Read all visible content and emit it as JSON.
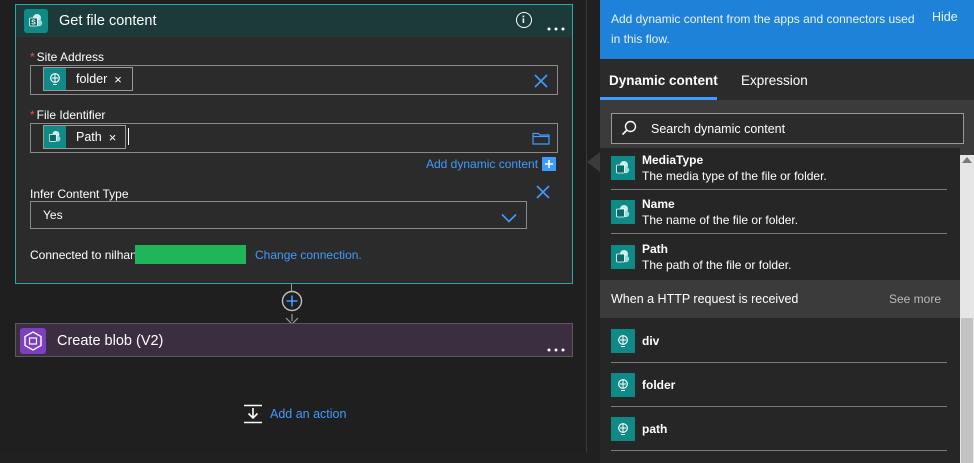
{
  "action": {
    "title": "Get file content",
    "site_address_label": "Site Address",
    "site_address_token": "folder",
    "file_identifier_label": "File Identifier",
    "file_identifier_token": "Path",
    "add_dynamic_content": "Add dynamic content",
    "infer_label": "Infer Content Type",
    "infer_value": "Yes",
    "connected_to": "Connected to nilhan",
    "change_connection": "Change connection.",
    "token_close": "×",
    "required_mark": "*"
  },
  "next_action": {
    "title": "Create blob (V2)"
  },
  "add_action": {
    "label": "Add an action"
  },
  "panel": {
    "banner_text": "Add dynamic content from the apps and connectors used in this flow.",
    "hide_label": "Hide",
    "tabs": [
      {
        "label": "Dynamic content",
        "active": true
      },
      {
        "label": "Expression",
        "active": false
      }
    ],
    "search_placeholder": "Search dynamic content",
    "sharepoint_items": [
      {
        "title": "MediaType",
        "desc": "The media type of the file or folder."
      },
      {
        "title": "Name",
        "desc": "The name of the file or folder."
      },
      {
        "title": "Path",
        "desc": "The path of the file or folder."
      }
    ],
    "section_title": "When a HTTP request is received",
    "see_more": "See more",
    "request_items": [
      {
        "title": "div"
      },
      {
        "title": "folder"
      },
      {
        "title": "path"
      }
    ]
  },
  "colors": {
    "accent_teal": "#0f8a86",
    "card_border": "#2ea6a1",
    "link_blue": "#3f9bff",
    "banner_blue": "#1e83d8",
    "masked_green": "#1fb65a"
  },
  "icons": {
    "sharepoint": "sharepoint-icon",
    "http": "http-request-icon",
    "blob": "blob-storage-icon"
  }
}
